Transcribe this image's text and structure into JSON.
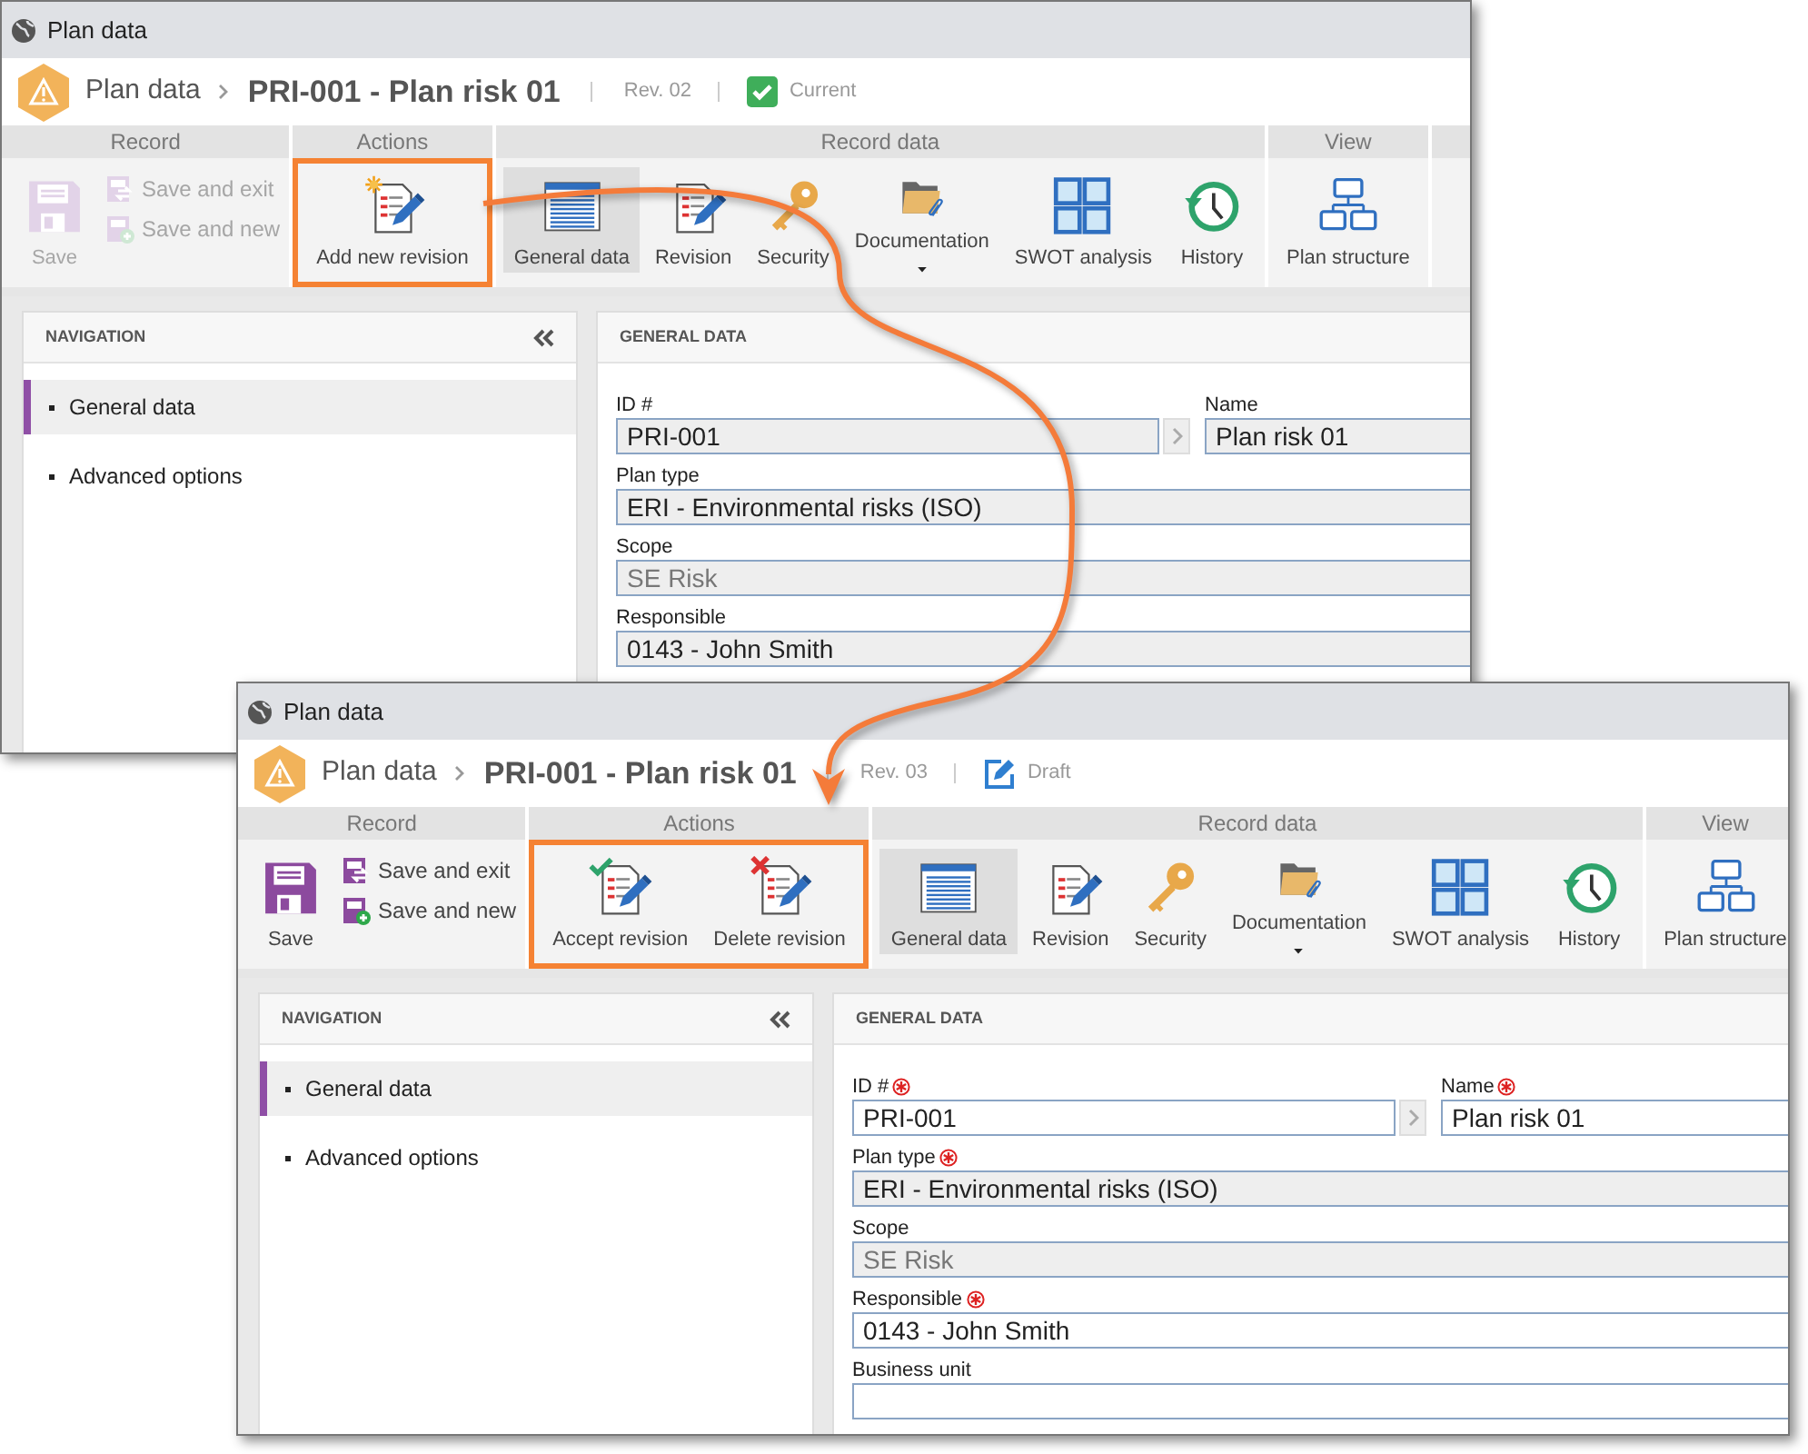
{
  "windows": [
    {
      "title": "Plan data",
      "breadcrumb": "Plan data",
      "record_title": "PRI-001 - Plan risk 01",
      "revision": "Rev. 02",
      "status": {
        "kind": "current",
        "label": "Current"
      },
      "ribbon": [
        {
          "label": "Record",
          "highlighted": false,
          "items": [
            {
              "kind": "save",
              "label": "Save",
              "disabled": true,
              "selected": false
            },
            {
              "kind": "save-exit",
              "label": "Save and exit",
              "disabled": true,
              "selected": false
            },
            {
              "kind": "save-new",
              "label": "Save and new",
              "disabled": true,
              "selected": false
            }
          ]
        },
        {
          "label": "Actions",
          "highlighted": true,
          "items": [
            {
              "kind": "add-revision",
              "label": "Add new revision",
              "disabled": false,
              "selected": false
            }
          ]
        },
        {
          "label": "Record data",
          "highlighted": false,
          "items": [
            {
              "kind": "general-data",
              "label": "General data",
              "disabled": false,
              "selected": true
            },
            {
              "kind": "revision",
              "label": "Revision",
              "disabled": false,
              "selected": false
            },
            {
              "kind": "security",
              "label": "Security",
              "disabled": false,
              "selected": false
            },
            {
              "kind": "documentation",
              "label": "Documentation",
              "disabled": false,
              "selected": false,
              "dropdown": true
            },
            {
              "kind": "swot",
              "label": "SWOT analysis",
              "disabled": false,
              "selected": false
            },
            {
              "kind": "history",
              "label": "History",
              "disabled": false,
              "selected": false
            }
          ]
        },
        {
          "label": "View",
          "highlighted": false,
          "items": [
            {
              "kind": "plan-structure",
              "label": "Plan structure",
              "disabled": false,
              "selected": false
            }
          ]
        }
      ],
      "navigation": {
        "title": "NAVIGATION",
        "items": [
          {
            "label": "General data",
            "selected": true
          },
          {
            "label": "Advanced options",
            "selected": false
          }
        ]
      },
      "form": {
        "title": "GENERAL DATA",
        "rows": [
          [
            {
              "label": "ID #",
              "value": "PRI-001",
              "kind": "lookup",
              "required": false,
              "disabled": true
            },
            {
              "label": "Name",
              "value": "Plan risk 01",
              "kind": "text",
              "required": false,
              "disabled": true
            }
          ],
          [
            {
              "label": "Plan type",
              "value": "ERI - Environmental risks (ISO)",
              "kind": "text",
              "required": false,
              "disabled": true
            }
          ],
          [
            {
              "label": "Scope",
              "value": "SE Risk",
              "kind": "readonly",
              "required": false,
              "disabled": true
            }
          ],
          [
            {
              "label": "Responsible",
              "value": "0143 - John Smith",
              "kind": "text",
              "required": false,
              "disabled": true
            }
          ]
        ]
      }
    },
    {
      "title": "Plan data",
      "breadcrumb": "Plan data",
      "record_title": "PRI-001 - Plan risk 01",
      "revision": "Rev. 03",
      "status": {
        "kind": "draft",
        "label": "Draft"
      },
      "ribbon": [
        {
          "label": "Record",
          "highlighted": false,
          "items": [
            {
              "kind": "save",
              "label": "Save",
              "disabled": false,
              "selected": false
            },
            {
              "kind": "save-exit",
              "label": "Save and exit",
              "disabled": false,
              "selected": false
            },
            {
              "kind": "save-new",
              "label": "Save and new",
              "disabled": false,
              "selected": false
            }
          ]
        },
        {
          "label": "Actions",
          "highlighted": true,
          "items": [
            {
              "kind": "accept-revision",
              "label": "Accept revision",
              "disabled": false,
              "selected": false
            },
            {
              "kind": "delete-revision",
              "label": "Delete revision",
              "disabled": false,
              "selected": false
            }
          ]
        },
        {
          "label": "Record data",
          "highlighted": false,
          "items": [
            {
              "kind": "general-data",
              "label": "General data",
              "disabled": false,
              "selected": true
            },
            {
              "kind": "revision",
              "label": "Revision",
              "disabled": false,
              "selected": false
            },
            {
              "kind": "security",
              "label": "Security",
              "disabled": false,
              "selected": false
            },
            {
              "kind": "documentation",
              "label": "Documentation",
              "disabled": false,
              "selected": false,
              "dropdown": true
            },
            {
              "kind": "swot",
              "label": "SWOT analysis",
              "disabled": false,
              "selected": false
            },
            {
              "kind": "history",
              "label": "History",
              "disabled": false,
              "selected": false
            }
          ]
        },
        {
          "label": "View",
          "highlighted": false,
          "items": [
            {
              "kind": "plan-structure",
              "label": "Plan structure",
              "disabled": false,
              "selected": false
            }
          ]
        }
      ],
      "navigation": {
        "title": "NAVIGATION",
        "items": [
          {
            "label": "General data",
            "selected": true
          },
          {
            "label": "Advanced options",
            "selected": false
          }
        ]
      },
      "form": {
        "title": "GENERAL DATA",
        "rows": [
          [
            {
              "label": "ID #",
              "value": "PRI-001",
              "kind": "lookup",
              "required": true,
              "disabled": false
            },
            {
              "label": "Name",
              "value": "Plan risk 01",
              "kind": "text",
              "required": true,
              "disabled": false
            }
          ],
          [
            {
              "label": "Plan type",
              "value": "ERI - Environmental risks (ISO)",
              "kind": "text",
              "required": true,
              "disabled": true
            }
          ],
          [
            {
              "label": "Scope",
              "value": "SE Risk",
              "kind": "readonly",
              "required": false,
              "disabled": true
            }
          ],
          [
            {
              "label": "Responsible",
              "value": "0143 - John Smith",
              "kind": "text",
              "required": true,
              "disabled": false
            }
          ],
          [
            {
              "label": "Business unit",
              "kind": "text",
              "required": false,
              "disabled": false
            }
          ]
        ]
      }
    }
  ]
}
